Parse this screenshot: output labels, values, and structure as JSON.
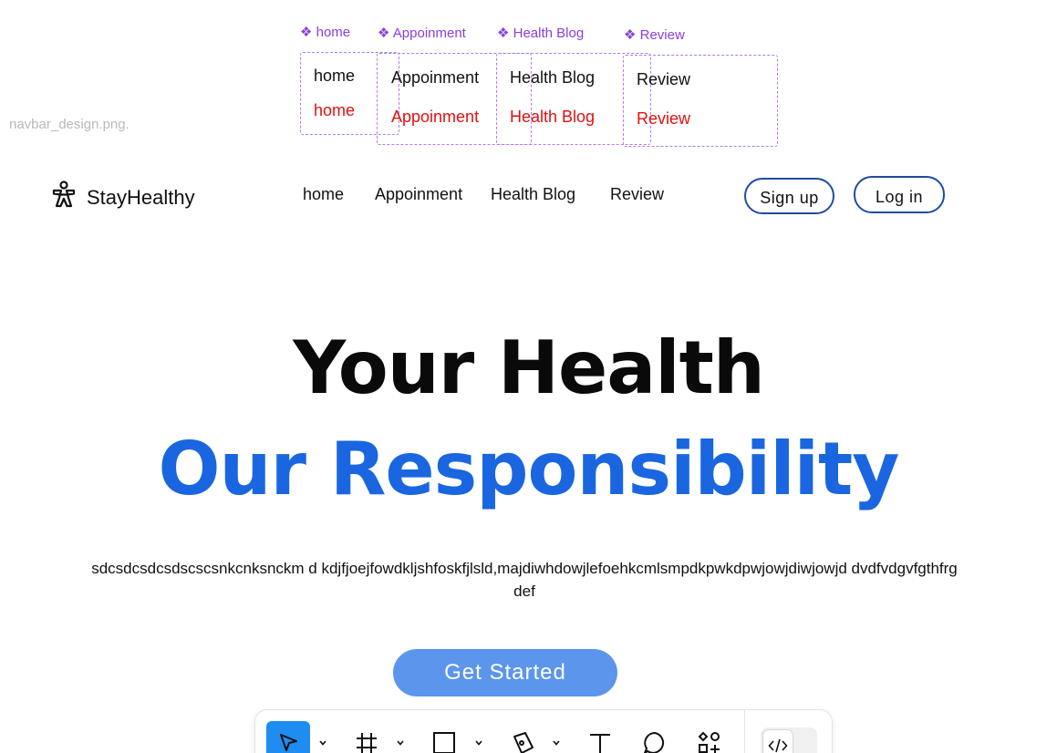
{
  "canvas": {
    "file_label": "navbar_design.png."
  },
  "components": [
    {
      "title": "❖ home",
      "variants": [
        "home",
        "home"
      ]
    },
    {
      "title": "❖ Appoinment",
      "variants": [
        "Appoinment",
        "Appoinment"
      ]
    },
    {
      "title": "❖ Health Blog",
      "variants": [
        "Health Blog",
        "Health Blog"
      ]
    },
    {
      "title": "❖ Review",
      "variants": [
        "Review",
        "Review"
      ]
    }
  ],
  "colors": {
    "component_purple": "#8a3ee0",
    "hover_red": "#e01010",
    "brand_blue": "#1a66e0",
    "button_border": "#1f4da0",
    "cta_blue": "#5b95ec",
    "tool_active": "#1e8cf0"
  },
  "navbar": {
    "logo_icon": "person-figure-icon",
    "logo_text": "StayHealthy",
    "links": [
      "home",
      "Appoinment",
      "Health Blog",
      "Review"
    ],
    "signup_label": "Sign up",
    "login_label": "Log in"
  },
  "hero": {
    "title_line1": "Your Health",
    "title_line2": "Our Responsibility",
    "subtitle": "sdcsdcsdcsdscscsnkcnksnckm d kdjfjoejfowdkljshfoskfjlsld,majdiwhdowjlefoehkcmlsmpdkpwkdpwjowjdiwjowjd dvdfvdgvfgthfrgdef",
    "cta_label": "Get Started"
  },
  "toolbar": {
    "tools": [
      "move-tool-icon",
      "frame-tool-icon",
      "rectangle-tool-icon",
      "pen-tool-icon",
      "text-tool-icon",
      "comment-tool-icon",
      "actions-tool-icon"
    ],
    "active_tool": "move-tool-icon",
    "dev_mode_icon": "code-icon"
  }
}
